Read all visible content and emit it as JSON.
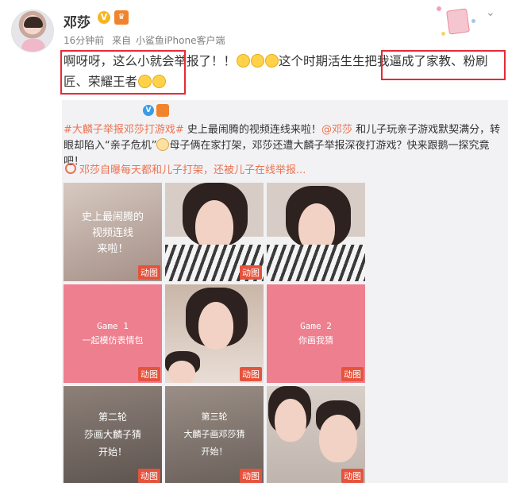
{
  "author": {
    "name": "邓莎",
    "verified_symbol": "V",
    "member_symbol": "♛"
  },
  "meta": {
    "time": "16分钟前",
    "from_label": "来自",
    "client": "小鲨鱼iPhone客户端"
  },
  "post": {
    "line1_part1": "啊呀呀，这么小就会举报了！！",
    "line1_part2": "这个时期活生生把我逼成了家教、粉刷",
    "line2": "匠、荣耀王者"
  },
  "repost": {
    "author_handle": "@​",
    "text_topic": "#大麟子举报邓莎打游戏#",
    "text_part1": " 史上最闹腾的视频连线来啦！",
    "mention": "@邓莎",
    "text_part2": " 和儿子玩亲子游戏默契满分，转眼却陷入“亲子危机”",
    "text_part3": "母子俩在家打架，邓莎还遭大麟子举报深夜打游戏？快来跟鹅一探究竟吧！",
    "sub_link": "邓莎自曝每天都和儿子打架，还被儿子在线举报..."
  },
  "tiles": [
    {
      "caption": "史上最闹腾的\n视频连线\n来啦！",
      "badge": "动图"
    },
    {
      "caption": "",
      "badge": "动图"
    },
    {
      "caption": "",
      "badge": ""
    },
    {
      "caption": "Game 1\n一起模仿表情包",
      "badge": "动图"
    },
    {
      "caption": "",
      "badge": "动图"
    },
    {
      "caption": "Game 2\n你画我猜",
      "badge": "动图"
    },
    {
      "caption": "第二轮\n莎画大麟子猜\n开始！",
      "badge": "动图"
    },
    {
      "caption": "第三轮\n大麟子画邓莎猜\n开始！",
      "badge": "动图"
    },
    {
      "caption": "",
      "badge": "动图"
    }
  ],
  "colors": {
    "highlight_box": "#e52b35",
    "link": "#eb7350",
    "badge": "#e5533d",
    "pink_tile": "#ee7f8e"
  }
}
